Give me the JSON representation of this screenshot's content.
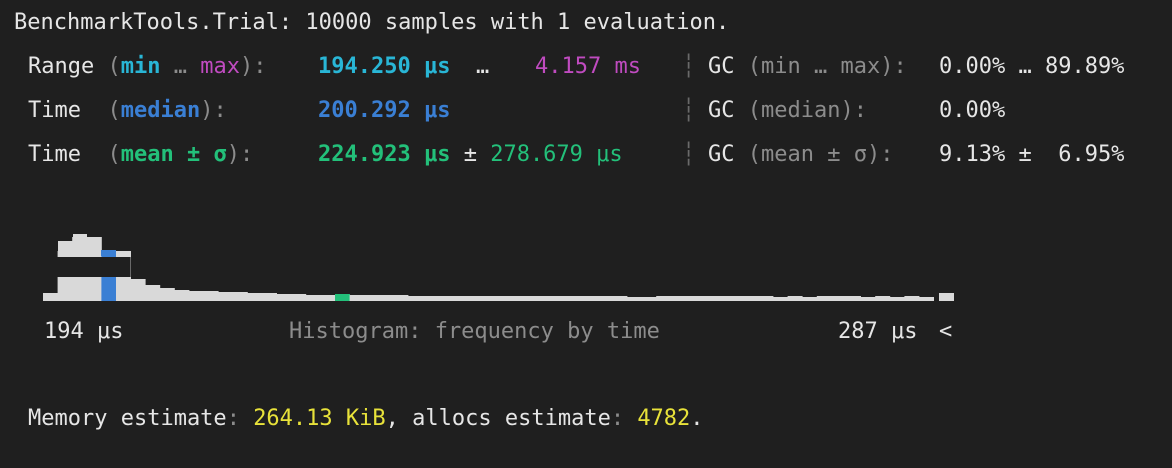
{
  "title": "BenchmarkTools.Trial: 10000 samples with 1 evaluation.",
  "range": {
    "label": "Range",
    "open": "(",
    "min": "min",
    "ellipsis": "…",
    "max": "max",
    "close": "):",
    "min_value": "194.250 μs",
    "max_value": "4.157 ms",
    "gc_label": "GC",
    "gc_open": "(min … max):",
    "gc_value": "0.00% … 89.89%"
  },
  "median": {
    "label": "Time",
    "open": "(",
    "key": "median",
    "close": "):",
    "value": "200.292 μs",
    "gc_label": "GC",
    "gc_open": "(median):",
    "gc_value": "0.00%"
  },
  "mean": {
    "label": "Time",
    "open": "(",
    "key": "mean ± σ",
    "close": "):",
    "value": "224.923 μs",
    "pm": "±",
    "sigma_value": "278.679 μs",
    "gc_label": "GC",
    "gc_open": "(mean ± σ):",
    "gc_value": "9.13% ±  6.95%"
  },
  "histogram": {
    "min_label": "194 μs",
    "caption": "Histogram: frequency by time",
    "max_label": "287 μs",
    "overflow_marker": "<",
    "bar_color": "#d9d9d9",
    "median_color": "#3a7fd4",
    "mean_color": "#23c07a"
  },
  "memory": {
    "label": "Memory estimate",
    "colon": ":",
    "value": "264.13 KiB",
    "allocs_label": ", allocs estimate",
    "allocs_colon": ":",
    "allocs_value": "4782",
    "end": "."
  },
  "separator": "┆"
}
